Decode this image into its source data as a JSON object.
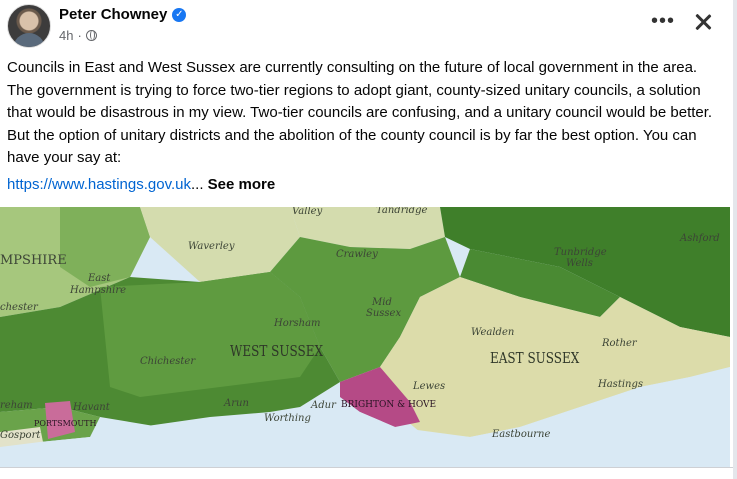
{
  "post": {
    "author": "Peter Chowney",
    "time": "4h",
    "text": "Councils in East and West Sussex are currently consulting on the future of local government in the area. The government is trying to force two-tier regions to adopt giant, county-sized unitary councils, a solution that would be disastrous in my view. Two-tier councils are confusing, and a unitary council would be better. But the option of unitary districts and the abolition of the county council is by far the best option. You can have your say at:",
    "link": "https://www.hastings.gov.uk",
    "ellipsis": "...",
    "see_more": "See more"
  },
  "icons": {
    "verified": "verified-badge-icon",
    "audience": "globe-icon",
    "more": "more-options-icon",
    "close": "close-icon"
  },
  "map": {
    "labels": {
      "valley": "Valley",
      "tandridge": "Tandridge",
      "ashford": "Ashford",
      "hampshire": "MPSHIRE",
      "waverley": "Waverley",
      "crawley": "Crawley",
      "tunbridge": "Tunbridge",
      "wells": "Wells",
      "east": "East",
      "hampshire_district": "Hampshire",
      "chester": "chester",
      "mid": "Mid",
      "sussex": "Sussex",
      "horsham": "Horsham",
      "wealden": "Wealden",
      "rother": "Rother",
      "chichester": "Chichester",
      "west_sussex": "WEST SUSSEX",
      "east_sussex": "EAST SUSSEX",
      "lewes": "Lewes",
      "hastings": "Hastings",
      "reham": "reham",
      "havant": "Havant",
      "arun": "Arun",
      "adur": "Adur",
      "brighton": "BRIGHTON & HOVE",
      "portsmouth": "PORTSMOUTH",
      "gosport": "Gosport",
      "worthing": "Worthing",
      "eastbourne": "Eastbourne"
    },
    "colors": {
      "sea": "#d9e9f4",
      "dark_green": "#3f7f2a",
      "mid_green": "#5d9a3f",
      "light_green": "#a6c77d",
      "pale_green": "#d4dcae",
      "cream": "#dcdcaa",
      "magenta": "#b54a86"
    }
  }
}
